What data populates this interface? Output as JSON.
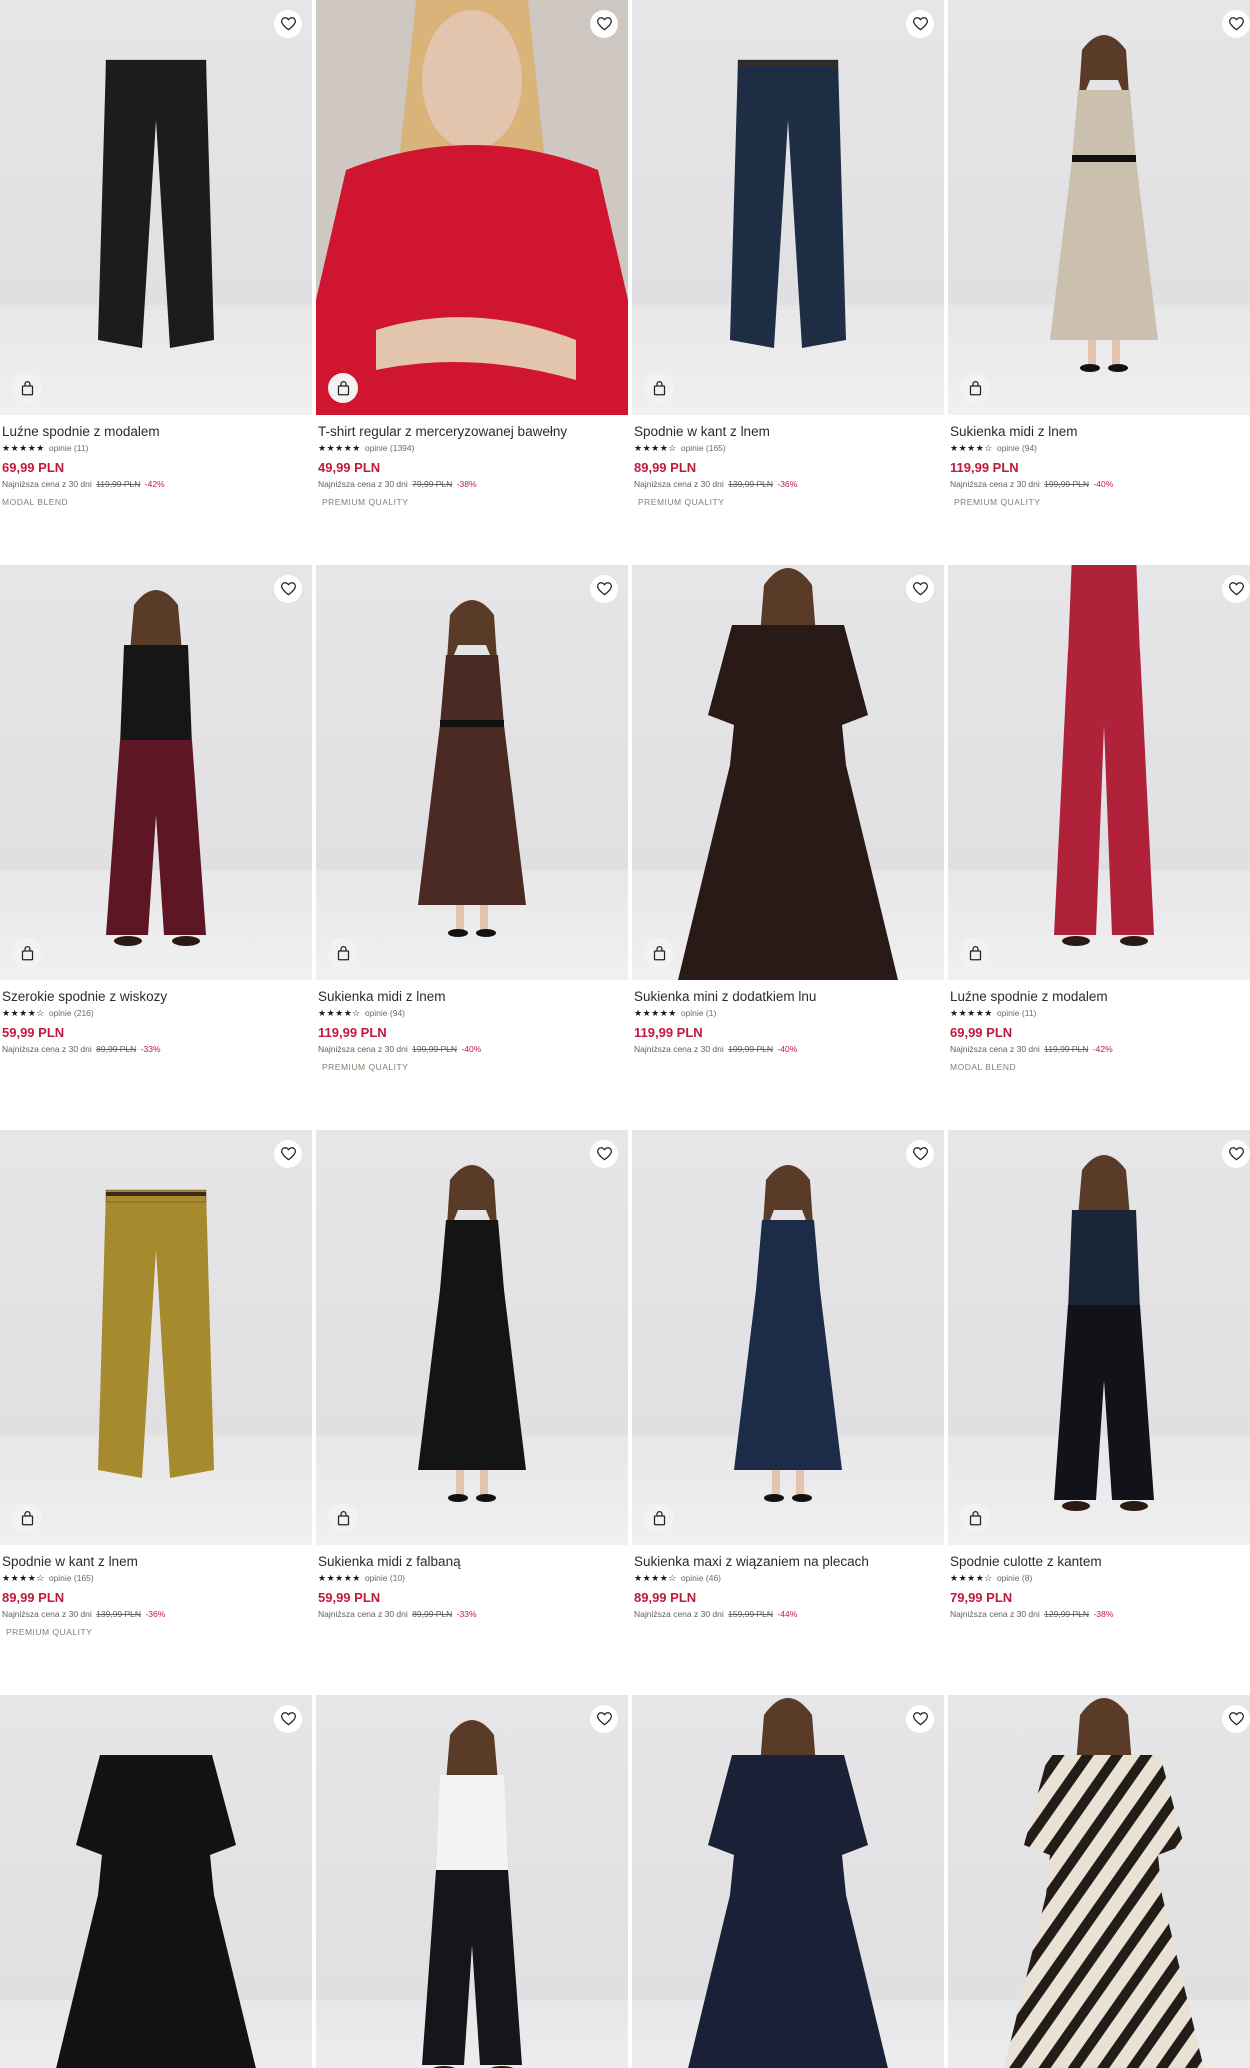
{
  "colors": {
    "price": "#c0193e",
    "discount": "#c0193e",
    "badge_text": "#8a7c6e",
    "image_background": "#e3e3e5"
  },
  "icons": {
    "favorite": "heart-icon",
    "add_to_cart": "shopping-bag-icon"
  },
  "lowest_price_label": "Najniższa cena z 30 dni",
  "products": [
    {
      "name": "Luźne spodnie z modalem",
      "stars": "★★★★★",
      "reviews": "opinie (11)",
      "price": "69,99 PLN",
      "old_price": "119,99 PLN",
      "discount": "-42%",
      "badge": "MODAL BLEND"
    },
    {
      "name": "T-shirt regular z merceryzowanej bawełny",
      "stars": "★★★★★",
      "reviews": "opinie (1394)",
      "price": "49,99 PLN",
      "old_price": "79,99 PLN",
      "discount": "-38%",
      "badge": "PREMIUM QUALITY"
    },
    {
      "name": "Spodnie w kant z lnem",
      "stars": "★★★★☆",
      "reviews": "opinie (165)",
      "price": "89,99 PLN",
      "old_price": "139,99 PLN",
      "discount": "-36%",
      "badge": "PREMIUM QUALITY"
    },
    {
      "name": "Sukienka midi z lnem",
      "stars": "★★★★☆",
      "reviews": "opinie (94)",
      "price": "119,99 PLN",
      "old_price": "199,99 PLN",
      "discount": "-40%",
      "badge": "PREMIUM QUALITY"
    },
    {
      "name": "Szerokie spodnie z wiskozy",
      "stars": "★★★★☆",
      "reviews": "opinie (216)",
      "price": "59,99 PLN",
      "old_price": "89,99 PLN",
      "discount": "-33%",
      "badge": ""
    },
    {
      "name": "Sukienka midi z lnem",
      "stars": "★★★★☆",
      "reviews": "opinie (94)",
      "price": "119,99 PLN",
      "old_price": "199,99 PLN",
      "discount": "-40%",
      "badge": "PREMIUM QUALITY"
    },
    {
      "name": "Sukienka mini z dodatkiem lnu",
      "stars": "★★★★★",
      "reviews": "opinie (1)",
      "price": "119,99 PLN",
      "old_price": "199,99 PLN",
      "discount": "-40%",
      "badge": ""
    },
    {
      "name": "Luźne spodnie z modalem",
      "stars": "★★★★★",
      "reviews": "opinie (11)",
      "price": "69,99 PLN",
      "old_price": "119,99 PLN",
      "discount": "-42%",
      "badge": "MODAL BLEND"
    },
    {
      "name": "Spodnie w kant z lnem",
      "stars": "★★★★☆",
      "reviews": "opinie (165)",
      "price": "89,99 PLN",
      "old_price": "139,99 PLN",
      "discount": "-36%",
      "badge": "PREMIUM QUALITY"
    },
    {
      "name": "Sukienka midi z falbaną",
      "stars": "★★★★★",
      "reviews": "opinie (10)",
      "price": "59,99 PLN",
      "old_price": "89,99 PLN",
      "discount": "-33%",
      "badge": ""
    },
    {
      "name": "Sukienka maxi z wiązaniem na plecach",
      "stars": "★★★★☆",
      "reviews": "opinie (46)",
      "price": "89,99 PLN",
      "old_price": "159,99 PLN",
      "discount": "-44%",
      "badge": ""
    },
    {
      "name": "Spodnie culotte z kantem",
      "stars": "★★★★☆",
      "reviews": "opinie (8)",
      "price": "79,99 PLN",
      "old_price": "129,99 PLN",
      "discount": "-38%",
      "badge": ""
    },
    {
      "name": "",
      "stars": "",
      "reviews": "",
      "price": "",
      "old_price": "",
      "discount": "",
      "badge": ""
    },
    {
      "name": "",
      "stars": "",
      "reviews": "",
      "price": "",
      "old_price": "",
      "discount": "",
      "badge": ""
    },
    {
      "name": "",
      "stars": "",
      "reviews": "",
      "price": "",
      "old_price": "",
      "discount": "",
      "badge": ""
    },
    {
      "name": "",
      "stars": "",
      "reviews": "",
      "price": "",
      "old_price": "",
      "discount": "",
      "badge": ""
    }
  ]
}
